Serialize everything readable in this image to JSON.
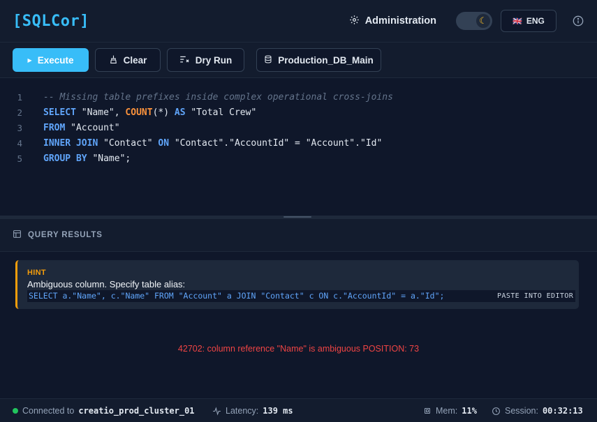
{
  "app": {
    "logo": "[SQLCor]",
    "admin_label": "Administration",
    "theme_icon": "moon-icon",
    "lang_flag": "🇬🇧",
    "lang_label": "ENG"
  },
  "toolbar": {
    "execute_label": "Execute",
    "clear_label": "Clear",
    "dry_run_label": "Dry Run",
    "database_label": "Production_DB_Main"
  },
  "editor": {
    "line_numbers": [
      "1",
      "2",
      "3",
      "4",
      "5"
    ]
  },
  "results": {
    "header_label": "QUERY RESULTS",
    "hint_title": "HINT",
    "hint_message": "Ambiguous column. Specify table alias:",
    "hint_sql": "SELECT a.\"Name\", c.\"Name\" FROM \"Account\" a JOIN \"Contact\" c ON c.\"AccountId\" = a.\"Id\";",
    "paste_label": "PASTE INTO EDITOR",
    "error_message": "42702: column reference \"Name\" is ambiguous POSITION: 73"
  },
  "status": {
    "connected_prefix": "Connected to",
    "cluster": "creatio_prod_cluster_01",
    "latency_prefix": "Latency:",
    "latency_value": "139 ms",
    "mem_prefix": "Mem:",
    "mem_value": "11%",
    "session_prefix": "Session:",
    "session_value": "00:32:13"
  },
  "colors": {
    "accent": "#38bdf8",
    "keyword": "#60a5fa",
    "function": "#fb923c",
    "hint": "#f59e0b",
    "error": "#ef4444",
    "connected": "#22c55e"
  }
}
